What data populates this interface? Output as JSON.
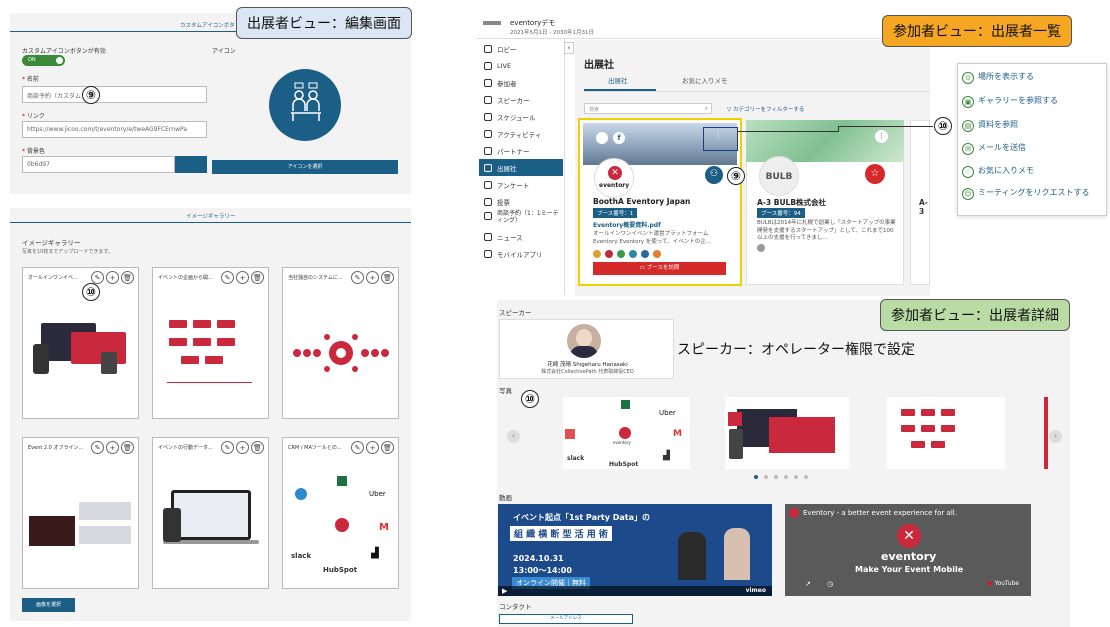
{
  "tags": {
    "exhibitor_edit": "出展者ビュー：編集画面",
    "attendee_list": "参加者ビュー：出展者一覧",
    "attendee_detail": "参加者ビュー：出展者詳細"
  },
  "markers": {
    "n9": "⑨",
    "n10": "⑩"
  },
  "edit": {
    "section_title": "カスタムアイコンボタ",
    "custom_icon_enabled_label": "カスタムアイコンボタンが有効",
    "toggle_label": "ON",
    "icon_label": "アイコン",
    "name_label": "名前",
    "name_value": "商談予約（カスタム",
    "link_label": "リンク",
    "link_value": "https://www.jicoo.com/t/eventory/e/tweAG9FCErnwPa",
    "bgcolor_label": "背景色",
    "bgcolor_value": "0b6d97",
    "select_icon_button": "アイコンを選択",
    "gallery_section_title": "イメージギャラリー",
    "gallery_label": "イメージギャラリー",
    "gallery_hint": "写真を10枚までアップロードできます。",
    "cards": [
      "オールインワンイベ...",
      "イベントの企画から開...",
      "当社独自のシステムに...",
      "Event 2.0 オフライン...",
      "イベントの行動データ...",
      "CRM / MAツールとの..."
    ],
    "select_image_button": "画像を選択"
  },
  "list": {
    "app_name": "eventoryデモ",
    "date_range": "2021年5月1日 - 2030年1月31日",
    "sidebar": [
      "ロビー",
      "LIVE",
      "参加者",
      "スピーカー",
      "スケジュール",
      "アクティビティ",
      "パートナー",
      "出展社",
      "アンケート",
      "投票",
      "商談予約（1：1ミーティング）",
      "ニュース",
      "モバイルアプリ"
    ],
    "page_title": "出展社",
    "tab_exhibitors": "出展社",
    "tab_favorites": "お気に入りメモ",
    "search_placeholder": "検索",
    "filter_label": "カテゴリーをフィルターする",
    "booth_a": {
      "name": "BoothA Eventory Japan",
      "badge": "ブース番号：1",
      "file": "Eventory概要資料.pdf",
      "desc": "オールインワンイベント運営プラットフォーム Eventory Eventory を使って、イベントの企...",
      "visit_button": "ブースを訪問",
      "logo_text": "eventory"
    },
    "booth_b": {
      "name": "A-3 BULB株式会社",
      "badge": "ブース番号：94",
      "desc": "BULBは2014年に札幌で創業し「スタートアップの事業開発を支援するスタートアップ」として、これまで100以上の支援を行ってきまし...",
      "logo_text": "BULB"
    },
    "booth_c_name": "A-3",
    "dropdown": [
      "場所を表示する",
      "ギャラリーを参照する",
      "資料を参照",
      "メールを送信",
      "お気に入りメモ",
      "ミーティングをリクエストする"
    ],
    "color_dots": [
      "#e0a030",
      "#c02a3a",
      "#3a9a4a",
      "#2a8aa0",
      "#2a6aa0",
      "#e08030"
    ]
  },
  "detail": {
    "speaker_label": "スピーカー",
    "speaker_name": "花崎 茂晴 Shigeharu Hanasaki",
    "speaker_org": "株式会社CollectivePath 代表取締役CEO",
    "speaker_note": "スピーカー：オペレーター権限で設定",
    "photos_label": "写真",
    "video_label": "動画",
    "video1_title": "イベント起点「1st Party Data」の",
    "video1_sub": "組 織 横 断 型 活 用 術",
    "video1_date": "2024.10.31",
    "video1_time": "13:00〜14:00",
    "video1_online": "オンライン開催｜無料",
    "video1_vimeo": "vimeo",
    "video2_title": "Eventory - a better event experience for all.",
    "video2_brand": "eventory",
    "video2_tagline": "Make Your Event Mobile",
    "video2_yt": "YouTube",
    "contact_label": "コンタクト",
    "mail_button": "メールアドレス",
    "logos": [
      "Uber",
      "slack",
      "HubSpot"
    ],
    "logo_center": "eventory"
  }
}
